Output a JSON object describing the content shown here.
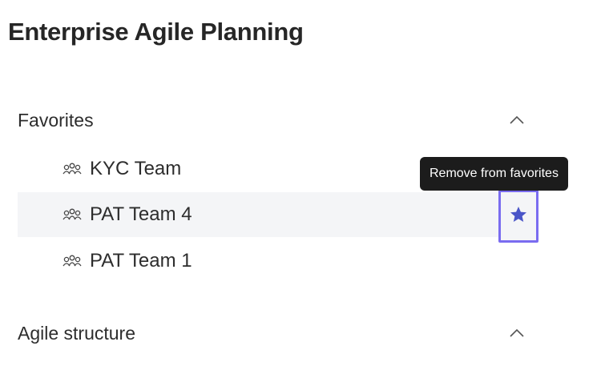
{
  "page": {
    "title": "Enterprise Agile Planning"
  },
  "sections": {
    "favorites": {
      "label": "Favorites",
      "items": [
        {
          "label": "KYC Team",
          "icon": "team-icon"
        },
        {
          "label": "PAT Team 4",
          "icon": "team-icon"
        },
        {
          "label": "PAT Team 1",
          "icon": "team-icon"
        }
      ]
    },
    "agile_structure": {
      "label": "Agile structure"
    }
  },
  "tooltip": {
    "text": "Remove from favorites"
  },
  "colors": {
    "accent": "#7a6cf0",
    "star": "#4a55c8",
    "hover_row": "#f4f5f7",
    "tooltip_bg": "#1c1c1c"
  }
}
